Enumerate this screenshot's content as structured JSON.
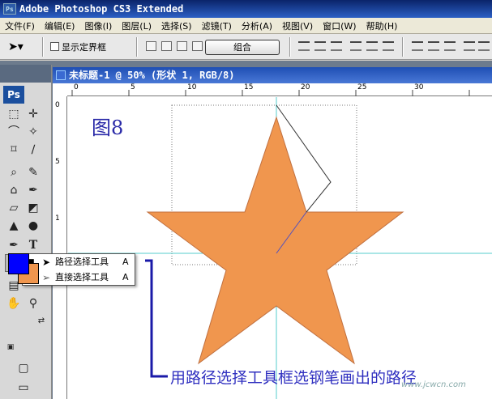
{
  "app": {
    "title": "Adobe Photoshop CS3 Extended",
    "logo_text": "Ps"
  },
  "menu": [
    "文件(F)",
    "编辑(E)",
    "图像(I)",
    "图层(L)",
    "选择(S)",
    "滤镜(T)",
    "分析(A)",
    "视图(V)",
    "窗口(W)",
    "帮助(H)"
  ],
  "options": {
    "show_bounding_box": "显示定界框",
    "show_bounding_box_checked": false,
    "combine_label": "组合"
  },
  "toolbox": {
    "badge": "Ps",
    "foreground_color": "#0000ff",
    "background_color": "#f0964e"
  },
  "document": {
    "title": "未标题-1 @ 50% (形状 1, RGB/8)",
    "ruler_top_labels": [
      "0",
      "5",
      "10",
      "15",
      "20",
      "25",
      "30"
    ],
    "ruler_left_labels": [
      "0",
      "5",
      "1",
      "1"
    ]
  },
  "canvas": {
    "figure_label": "图8",
    "star_color": "#f0964e"
  },
  "flyout": {
    "items": [
      {
        "label": "路径选择工具",
        "shortcut": "A",
        "selected": true
      },
      {
        "label": "直接选择工具",
        "shortcut": "A",
        "selected": false
      }
    ]
  },
  "annotation": {
    "text": "用路径选择工具框选钢笔画出的路径",
    "color": "#3030c0"
  },
  "watermark": {
    "text": "www.jcwcn.com"
  }
}
